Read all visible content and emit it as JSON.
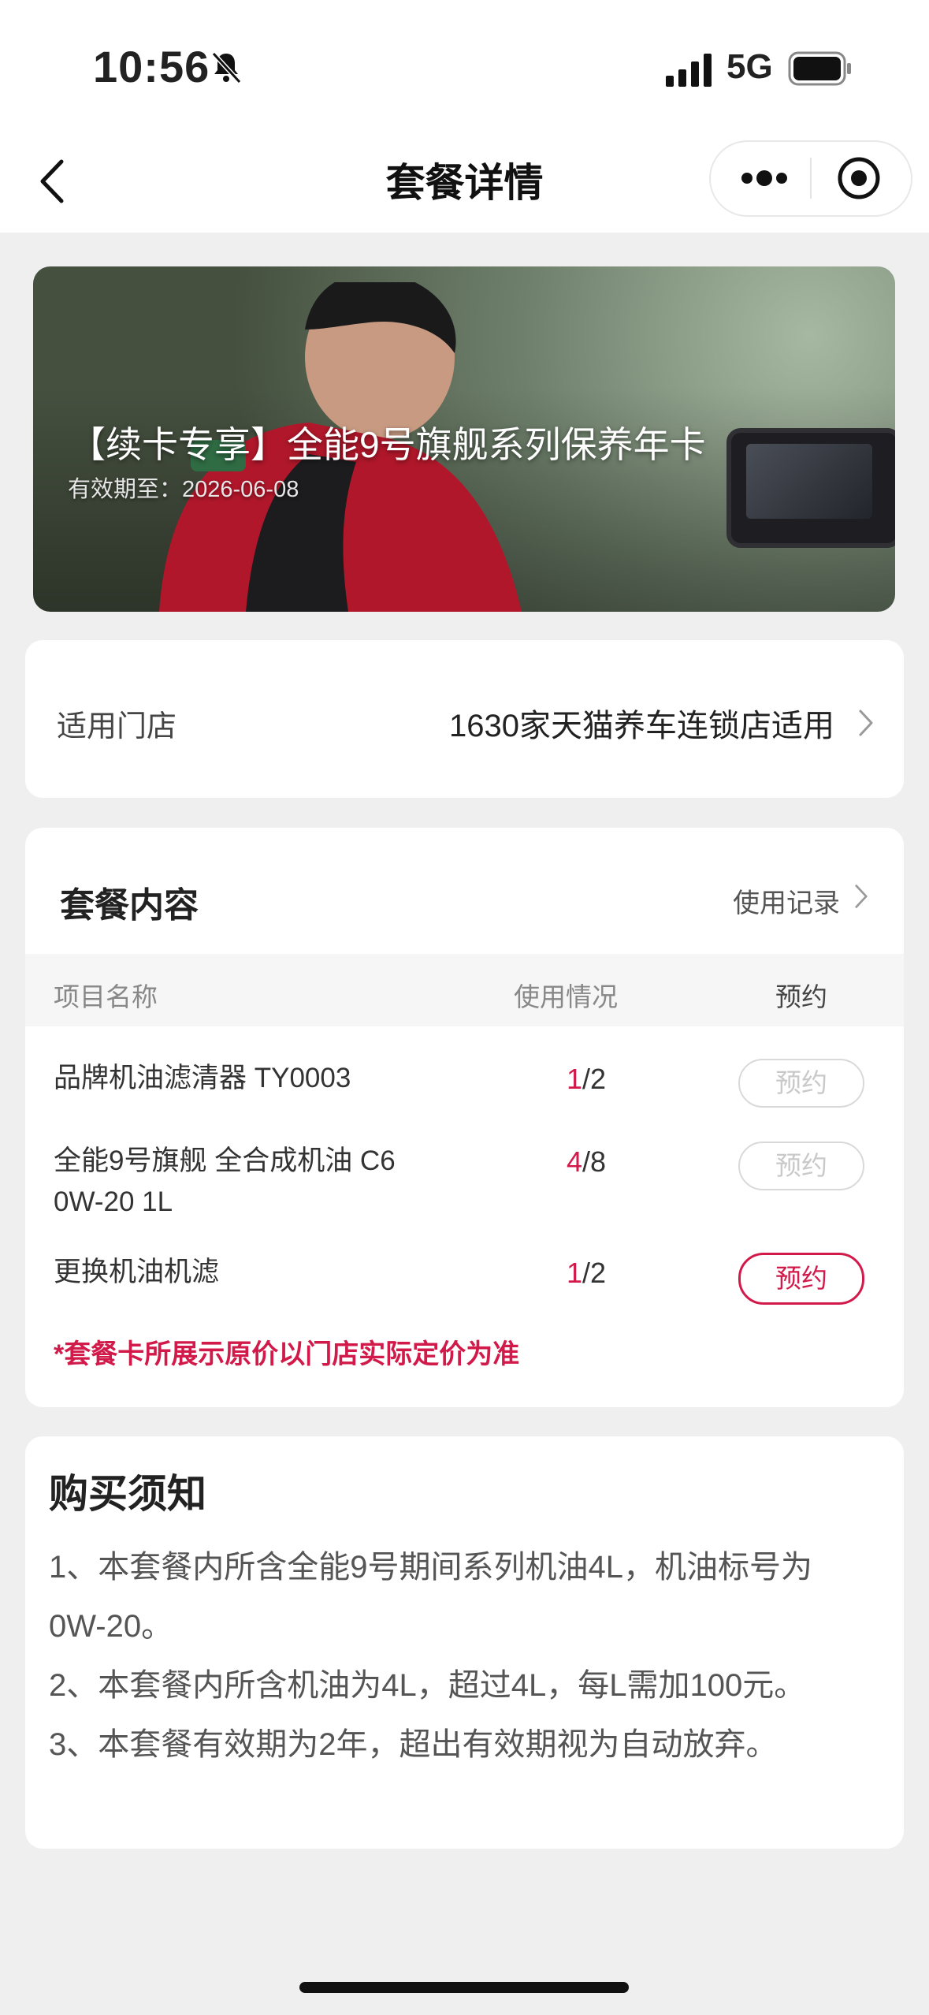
{
  "status_bar": {
    "time": "10:56",
    "network": "5G"
  },
  "nav": {
    "title": "套餐详情"
  },
  "banner": {
    "title": "【续卡专享】全能9号旗舰系列保养年卡",
    "valid_until": "有效期至：2026-06-08"
  },
  "store": {
    "label": "适用门店",
    "value": "1630家天猫养车连锁店适用"
  },
  "package": {
    "title": "套餐内容",
    "record_link": "使用记录",
    "columns": [
      "项目名称",
      "使用情况",
      "预约"
    ],
    "items": [
      {
        "name": "品牌机油滤清器 TY0003",
        "used": "1",
        "total": "/2",
        "button": "预约",
        "enabled": false
      },
      {
        "name": "全能9号旗舰 全合成机油 C6 0W-20 1L",
        "used": "4",
        "total": "/8",
        "button": "预约",
        "enabled": false
      },
      {
        "name": "更换机油机滤",
        "used": "1",
        "total": "/2",
        "button": "预约",
        "enabled": true
      }
    ],
    "note": "*套餐卡所展示原价以门店实际定价为准"
  },
  "notice": {
    "title": "购买须知",
    "lines": [
      "1、本套餐内所含全能9号期间系列机油4L，机油标号为",
      "0W-20。",
      "2、本套餐内所含机油为4L，超过4L，每L需加100元。",
      "3、本套餐有效期为2年，超出有效期视为自动放弃。"
    ]
  },
  "colors": {
    "accent": "#d21a4a",
    "background": "#efefef",
    "card": "#ffffff"
  }
}
